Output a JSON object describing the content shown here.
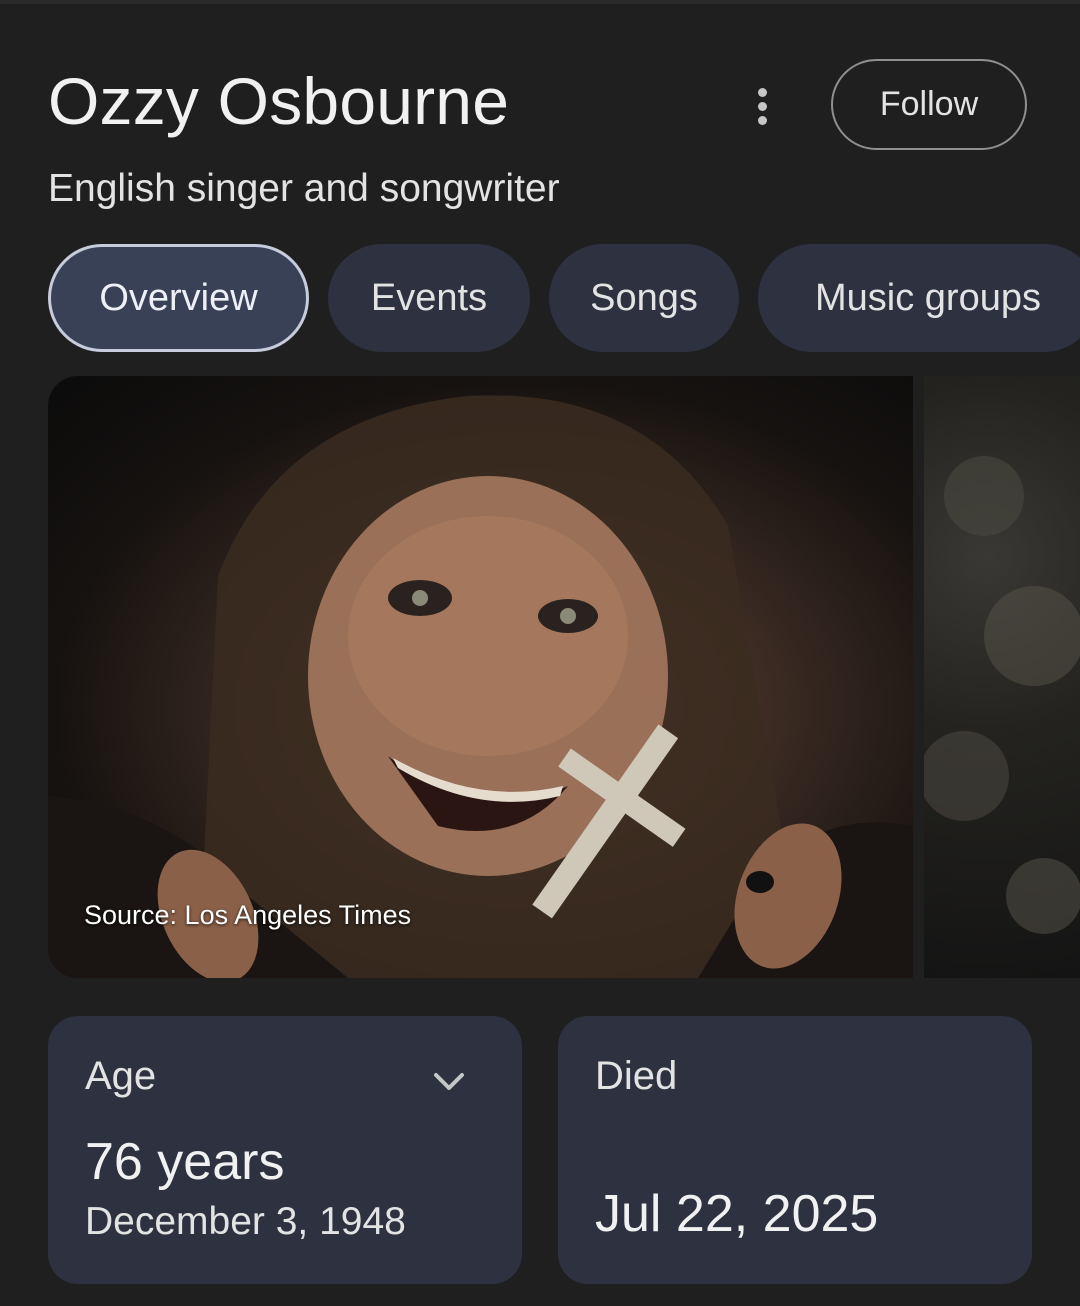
{
  "header": {
    "title": "Ozzy Osbourne",
    "subtitle": "English singer and songwriter",
    "follow_label": "Follow",
    "more_icon": "more-vert-icon"
  },
  "tabs": [
    {
      "label": "Overview",
      "active": true
    },
    {
      "label": "Events",
      "active": false
    },
    {
      "label": "Songs",
      "active": false
    },
    {
      "label": "Music groups",
      "active": false
    }
  ],
  "images": {
    "main_source": "Source: Los Angeles Times"
  },
  "facts": {
    "age": {
      "label": "Age",
      "value": "76 years",
      "detail": "December 3, 1948",
      "icon": "chevron-down-icon"
    },
    "died": {
      "label": "Died",
      "value": "Jul 22, 2025"
    }
  },
  "colors": {
    "background": "#1f1f1f",
    "chip": "#2d3140",
    "chip_active": "#394157",
    "card": "#2d3140"
  }
}
